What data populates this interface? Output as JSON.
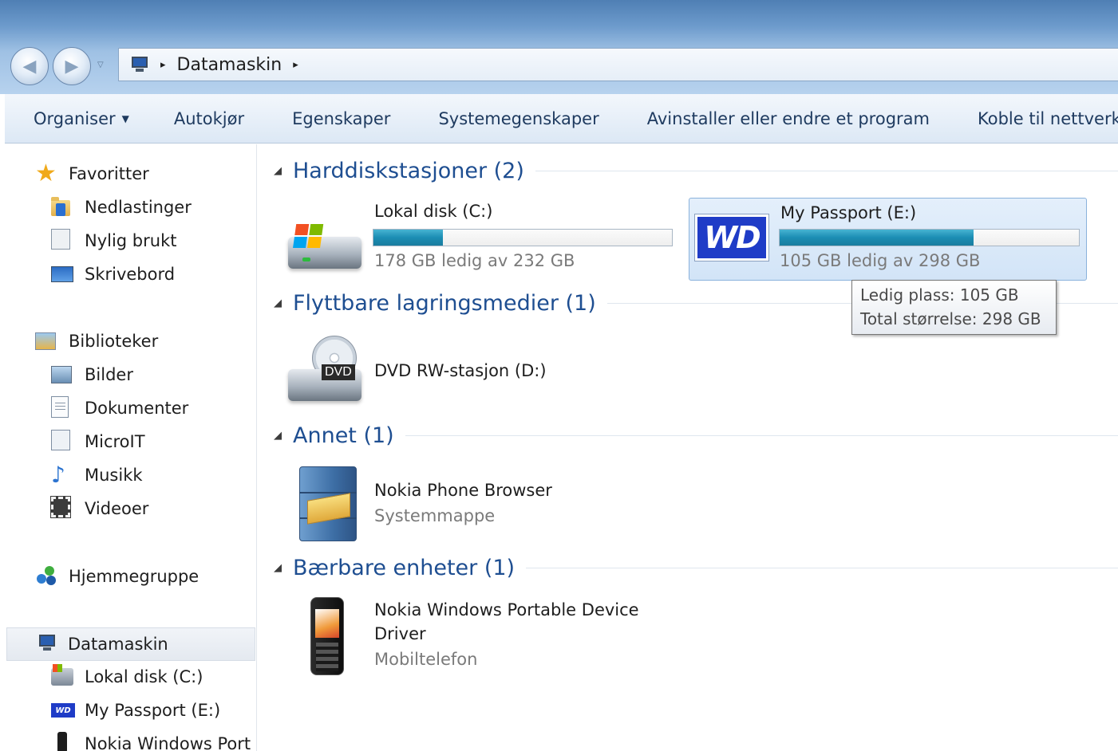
{
  "address": {
    "location": "Datamaskin",
    "path_arrow": "▸"
  },
  "toolbar": {
    "items": [
      "Organiser",
      "Autokjør",
      "Egenskaper",
      "Systemegenskaper",
      "Avinstaller eller endre et program",
      "Koble til nettverk"
    ]
  },
  "nav": {
    "favorites": "Favoritter",
    "downloads": "Nedlastinger",
    "recent": "Nylig brukt",
    "desktop": "Skrivebord",
    "libraries": "Biblioteker",
    "pictures": "Bilder",
    "documents": "Dokumenter",
    "microit": "MicroIT",
    "music": "Musikk",
    "videos": "Videoer",
    "homegroup": "Hjemmegruppe",
    "computer": "Datamaskin",
    "local_disk": "Lokal disk (C:)",
    "my_passport": "My Passport (E:)",
    "nokia": "Nokia Windows Port"
  },
  "groups": {
    "hdd": "Harddiskstasjoner (2)",
    "removable": "Flyttbare lagringsmedier (1)",
    "other": "Annet (1)",
    "portable": "Bærbare enheter (1)"
  },
  "drives": {
    "c": {
      "name": "Lokal disk (C:)",
      "space": "178 GB ledig av 232 GB",
      "used_fraction": 0.233
    },
    "e": {
      "name": "My Passport (E:)",
      "space": "105 GB ledig av 298 GB",
      "used_fraction": 0.648,
      "logo": "WD"
    },
    "d": {
      "name": "DVD RW-stasjon (D:)",
      "label": "DVD"
    }
  },
  "other_items": {
    "nokia_browser": {
      "name": "Nokia Phone Browser",
      "sub": "Systemmappe"
    }
  },
  "portable_items": {
    "nokia_device": {
      "name_line1": "Nokia Windows Portable Device",
      "name_line2": "Driver",
      "sub": "Mobiltelefon"
    }
  },
  "tooltip": {
    "line1": "Ledig plass: 105 GB",
    "line2": "Total størrelse: 298 GB"
  },
  "colors": {
    "group_header": "#1e4e91",
    "bar_fill": "#1b8db3",
    "wd_brand": "#1f3cc7",
    "selection": "#d2e4f7"
  }
}
